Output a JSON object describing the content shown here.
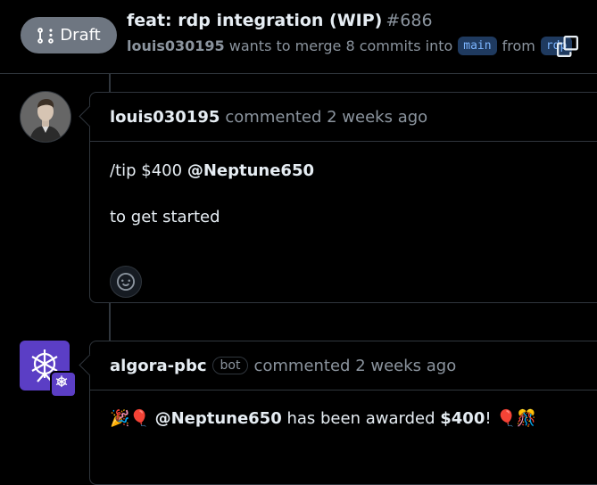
{
  "header": {
    "draft_label": "Draft",
    "title": "feat: rdp integration (WIP)",
    "number": "#686",
    "author": "louis030195",
    "merge_text": "wants to merge 8 commits into",
    "base_branch": "main",
    "from_text": "from",
    "head_branch": "rdp"
  },
  "comments": [
    {
      "author": "louis030195",
      "action": "commented 2 weeks ago",
      "line1_prefix": "/tip $400",
      "line1_mention": "@Neptune650",
      "line2": "to get started"
    },
    {
      "author": "algora-pbc",
      "badge": "bot",
      "action": "commented 2 weeks ago",
      "emoji_start": "🎉🎈",
      "mention": "@Neptune650",
      "text_mid": "has been awarded",
      "amount": "$400",
      "text_end": "!",
      "emoji_end": "🎈🎊"
    }
  ],
  "colors": {
    "background": "#000000",
    "border": "#30363d",
    "muted": "#8b949e",
    "draft_badge": "#6e7681",
    "bot_avatar": "#5b3ec5"
  }
}
